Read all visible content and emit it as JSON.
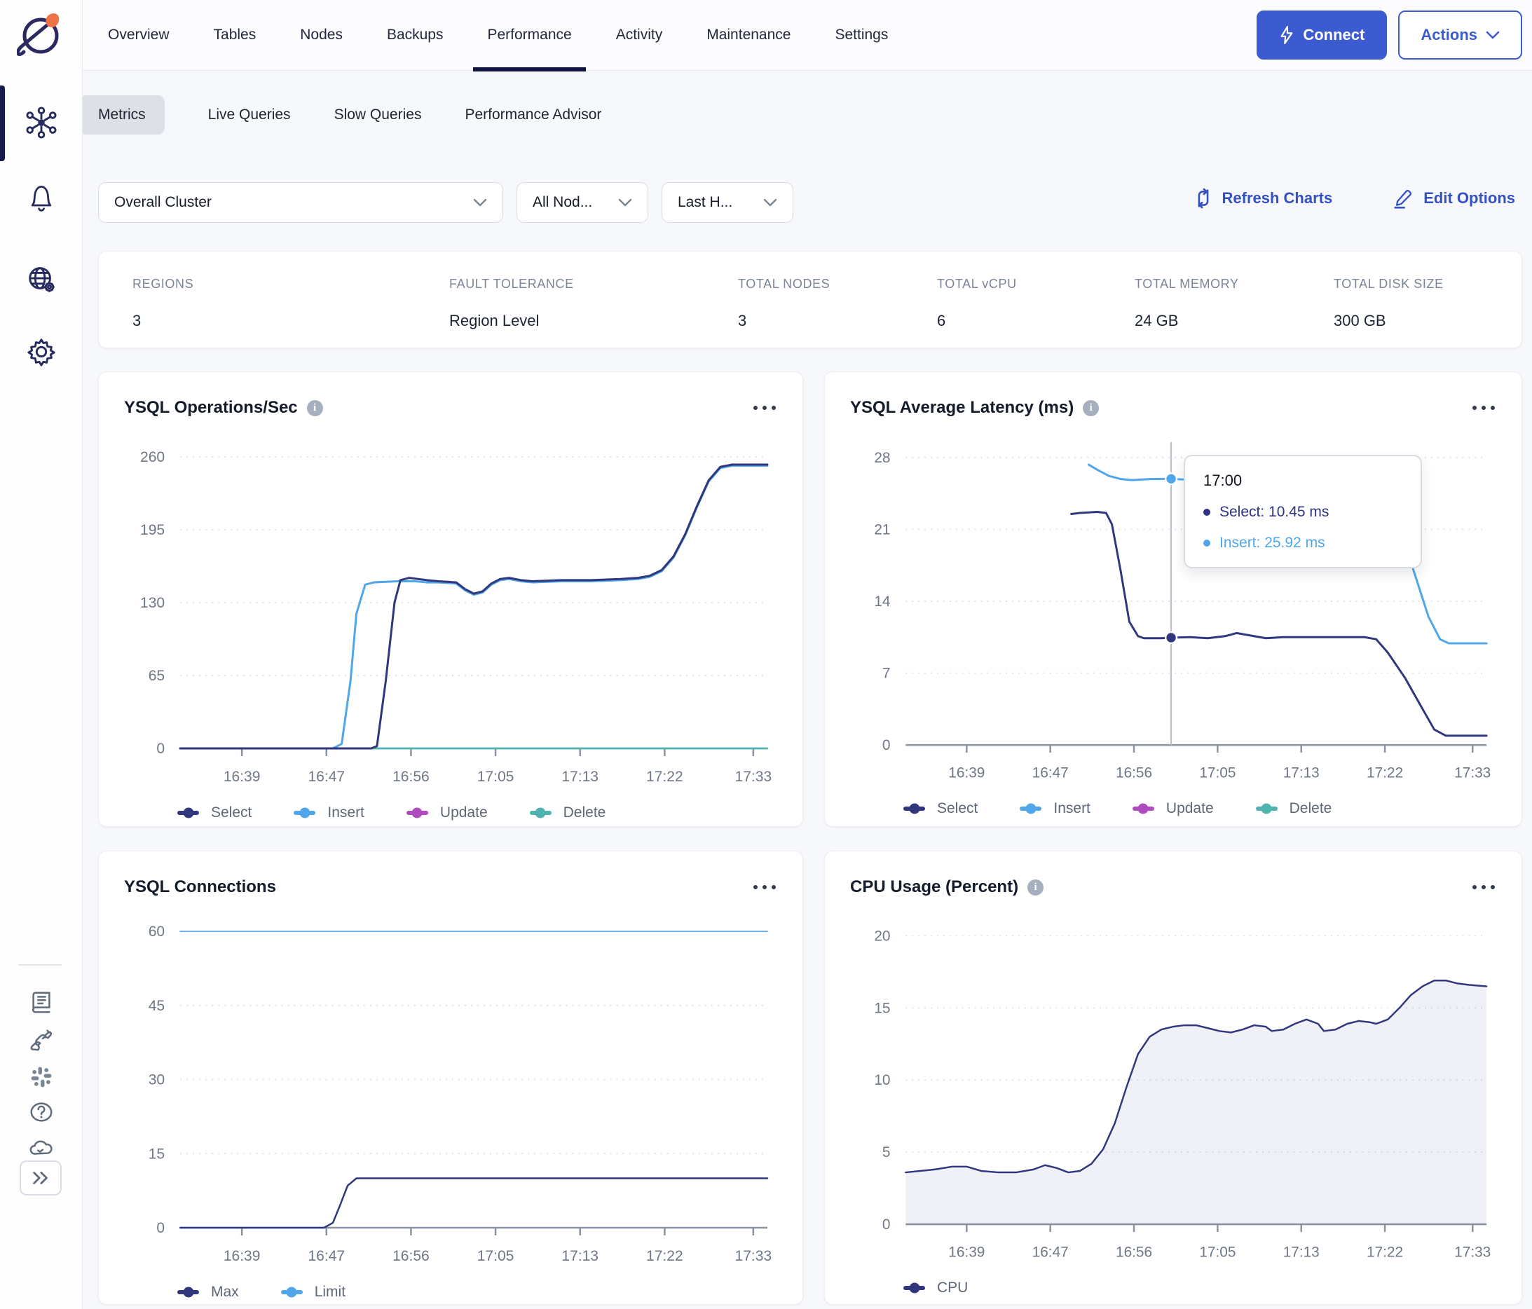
{
  "colors": {
    "brand_blue": "#3D5BD0",
    "link_blue": "#3451C0",
    "navy_series": "#31377D",
    "blue_series": "#4FA7E9",
    "magenta_series": "#B04ABF",
    "teal_series": "#4FB3AF",
    "active_tab_underline": "#12153F"
  },
  "sidebar": {
    "icons_top": [
      "yugabyte-logo",
      "cluster-icon",
      "bell-icon",
      "globe-gear-icon",
      "gear-icon"
    ],
    "icons_bottom": [
      "book-icon",
      "plug-icon",
      "slack-icon",
      "help-icon",
      "cloud-icon",
      "expand-icon"
    ]
  },
  "header": {
    "tabs": [
      "Overview",
      "Tables",
      "Nodes",
      "Backups",
      "Performance",
      "Activity",
      "Maintenance",
      "Settings"
    ],
    "active_tab": "Performance",
    "connect_label": "Connect",
    "actions_label": "Actions"
  },
  "subtabs": {
    "items": [
      "Metrics",
      "Live Queries",
      "Slow Queries",
      "Performance Advisor"
    ],
    "active": "Metrics"
  },
  "filters": {
    "cluster_value": "Overall Cluster",
    "nodes_value": "All Nod...",
    "time_value": "Last H...",
    "refresh_label": "Refresh Charts",
    "edit_label": "Edit Options"
  },
  "stats": [
    {
      "label": "REGIONS",
      "value": "3"
    },
    {
      "label": "FAULT TOLERANCE",
      "value": "Region Level"
    },
    {
      "label": "TOTAL NODES",
      "value": "3"
    },
    {
      "label": "TOTAL vCPU",
      "value": "6"
    },
    {
      "label": "TOTAL MEMORY",
      "value": "24 GB"
    },
    {
      "label": "TOTAL DISK SIZE",
      "value": "300 GB"
    }
  ],
  "charts": [
    {
      "title": "YSQL Operations/Sec",
      "type": "line",
      "has_info": true,
      "ylim": [
        0,
        273
      ],
      "yticks": [
        0,
        65,
        130,
        195,
        260
      ],
      "xticks": [
        {
          "label": "16:39",
          "f": 0.105
        },
        {
          "label": "16:47",
          "f": 0.249
        },
        {
          "label": "16:56",
          "f": 0.393
        },
        {
          "label": "17:05",
          "f": 0.537
        },
        {
          "label": "17:13",
          "f": 0.681
        },
        {
          "label": "17:22",
          "f": 0.825
        },
        {
          "label": "17:33",
          "f": 0.976
        }
      ],
      "series": [
        {
          "name": "Delete",
          "color": "#4FB3AF",
          "width": 2.5,
          "points": [
            [
              0,
              0
            ],
            [
              1,
              0
            ]
          ]
        },
        {
          "name": "Insert",
          "color": "#4FA7E9",
          "points": [
            [
              0,
              0
            ],
            [
              0.26,
              0
            ],
            [
              0.275,
              4
            ],
            [
              0.29,
              60
            ],
            [
              0.3,
              120
            ],
            [
              0.315,
              146
            ],
            [
              0.33,
              148
            ],
            [
              0.37,
              149
            ],
            [
              0.4,
              149
            ],
            [
              0.42,
              148
            ],
            [
              0.44,
              148
            ],
            [
              0.47,
              147
            ],
            [
              0.485,
              141
            ],
            [
              0.5,
              137
            ],
            [
              0.515,
              139
            ],
            [
              0.53,
              146
            ],
            [
              0.545,
              150
            ],
            [
              0.56,
              151
            ],
            [
              0.58,
              149
            ],
            [
              0.6,
              148
            ],
            [
              0.65,
              149
            ],
            [
              0.7,
              149
            ],
            [
              0.75,
              150
            ],
            [
              0.78,
              151
            ],
            [
              0.8,
              153
            ],
            [
              0.82,
              158
            ],
            [
              0.84,
              170
            ],
            [
              0.86,
              190
            ],
            [
              0.88,
              215
            ],
            [
              0.9,
              238
            ],
            [
              0.92,
              250
            ],
            [
              0.94,
              252
            ],
            [
              1,
              252
            ]
          ]
        },
        {
          "name": "Select",
          "color": "#31377D",
          "points": [
            [
              0,
              0
            ],
            [
              0.325,
              0
            ],
            [
              0.335,
              2
            ],
            [
              0.35,
              60
            ],
            [
              0.365,
              130
            ],
            [
              0.375,
              150
            ],
            [
              0.39,
              152
            ],
            [
              0.42,
              150
            ],
            [
              0.44,
              149
            ],
            [
              0.47,
              148
            ],
            [
              0.485,
              142
            ],
            [
              0.5,
              138
            ],
            [
              0.515,
              140
            ],
            [
              0.53,
              147
            ],
            [
              0.545,
              151
            ],
            [
              0.56,
              152
            ],
            [
              0.58,
              150
            ],
            [
              0.6,
              149
            ],
            [
              0.65,
              150
            ],
            [
              0.7,
              150
            ],
            [
              0.75,
              151
            ],
            [
              0.78,
              152
            ],
            [
              0.8,
              154
            ],
            [
              0.82,
              159
            ],
            [
              0.84,
              171
            ],
            [
              0.86,
              191
            ],
            [
              0.88,
              216
            ],
            [
              0.9,
              239
            ],
            [
              0.92,
              251
            ],
            [
              0.94,
              253
            ],
            [
              1,
              253
            ]
          ]
        }
      ],
      "legend": [
        {
          "label": "Select",
          "color": "#31377D"
        },
        {
          "label": "Insert",
          "color": "#4FA7E9"
        },
        {
          "label": "Update",
          "color": "#B04ABF"
        },
        {
          "label": "Delete",
          "color": "#4FB3AF"
        }
      ]
    },
    {
      "title": "YSQL Average Latency (ms)",
      "type": "line",
      "has_info": true,
      "ylim": [
        0,
        29.5
      ],
      "yticks": [
        0,
        7,
        14,
        21,
        28
      ],
      "xticks": [
        {
          "label": "16:39",
          "f": 0.105
        },
        {
          "label": "16:47",
          "f": 0.249
        },
        {
          "label": "16:56",
          "f": 0.393
        },
        {
          "label": "17:05",
          "f": 0.537
        },
        {
          "label": "17:13",
          "f": 0.681
        },
        {
          "label": "17:22",
          "f": 0.825
        },
        {
          "label": "17:33",
          "f": 0.976
        }
      ],
      "series": [
        {
          "name": "Insert",
          "color": "#4FA7E9",
          "points": [
            [
              0.315,
              27.3
            ],
            [
              0.33,
              26.8
            ],
            [
              0.35,
              26.2
            ],
            [
              0.37,
              25.9
            ],
            [
              0.39,
              25.8
            ],
            [
              0.42,
              25.9
            ],
            [
              0.457,
              25.92
            ],
            [
              0.5,
              25.8
            ],
            [
              0.53,
              25.8
            ],
            [
              0.56,
              26.0
            ],
            [
              0.6,
              26.2
            ],
            [
              0.63,
              26.1
            ],
            [
              0.66,
              25.9
            ],
            [
              0.7,
              25.8
            ],
            [
              0.73,
              25.8
            ],
            [
              0.76,
              25.8
            ],
            [
              0.79,
              25.7
            ],
            [
              0.81,
              25.0
            ],
            [
              0.83,
              23.0
            ],
            [
              0.86,
              19.5
            ],
            [
              0.88,
              16.0
            ],
            [
              0.9,
              12.5
            ],
            [
              0.92,
              10.3
            ],
            [
              0.935,
              9.9
            ],
            [
              1,
              9.9
            ]
          ]
        },
        {
          "name": "Select",
          "color": "#31377D",
          "points": [
            [
              0.285,
              22.5
            ],
            [
              0.3,
              22.6
            ],
            [
              0.33,
              22.7
            ],
            [
              0.345,
              22.6
            ],
            [
              0.355,
              21.5
            ],
            [
              0.37,
              17.0
            ],
            [
              0.385,
              12.0
            ],
            [
              0.4,
              10.6
            ],
            [
              0.41,
              10.4
            ],
            [
              0.44,
              10.4
            ],
            [
              0.457,
              10.45
            ],
            [
              0.49,
              10.5
            ],
            [
              0.52,
              10.4
            ],
            [
              0.55,
              10.6
            ],
            [
              0.57,
              10.9
            ],
            [
              0.59,
              10.7
            ],
            [
              0.62,
              10.4
            ],
            [
              0.65,
              10.5
            ],
            [
              0.7,
              10.5
            ],
            [
              0.75,
              10.5
            ],
            [
              0.79,
              10.5
            ],
            [
              0.81,
              10.3
            ],
            [
              0.83,
              9.0
            ],
            [
              0.86,
              6.5
            ],
            [
              0.89,
              3.5
            ],
            [
              0.91,
              1.5
            ],
            [
              0.93,
              0.9
            ],
            [
              1,
              0.9
            ]
          ]
        }
      ],
      "crosshair": {
        "f": 0.457,
        "dots": [
          {
            "v": 25.92,
            "color": "#4FA7E9"
          },
          {
            "v": 10.45,
            "color": "#31377D"
          }
        ]
      },
      "tooltip": {
        "time": "17:00",
        "rows": [
          {
            "text": "Select: 10.45 ms",
            "color": "#2D3282"
          },
          {
            "text": "Insert: 25.92 ms",
            "color": "#4FA7E9"
          }
        ]
      },
      "legend": [
        {
          "label": "Select",
          "color": "#31377D"
        },
        {
          "label": "Insert",
          "color": "#4FA7E9"
        },
        {
          "label": "Update",
          "color": "#B04ABF"
        },
        {
          "label": "Delete",
          "color": "#4FB3AF"
        }
      ]
    },
    {
      "title": "YSQL Connections",
      "type": "line",
      "has_info": false,
      "ylim": [
        0,
        62
      ],
      "yticks": [
        0,
        15,
        30,
        45,
        60
      ],
      "xticks": [
        {
          "label": "16:39",
          "f": 0.105
        },
        {
          "label": "16:47",
          "f": 0.249
        },
        {
          "label": "16:56",
          "f": 0.393
        },
        {
          "label": "17:05",
          "f": 0.537
        },
        {
          "label": "17:13",
          "f": 0.681
        },
        {
          "label": "17:22",
          "f": 0.825
        },
        {
          "label": "17:33",
          "f": 0.976
        }
      ],
      "series": [
        {
          "name": "Limit",
          "color": "#6FB3EC",
          "width": 2,
          "points": [
            [
              0,
              60
            ],
            [
              1,
              60
            ]
          ]
        },
        {
          "name": "Max",
          "color": "#31377D",
          "width": 2.5,
          "points": [
            [
              0,
              0
            ],
            [
              0.245,
              0
            ],
            [
              0.26,
              1
            ],
            [
              0.272,
              4.5
            ],
            [
              0.285,
              8.5
            ],
            [
              0.3,
              10
            ],
            [
              1,
              10
            ]
          ]
        }
      ],
      "legend": [
        {
          "label": "Max",
          "color": "#31377D"
        },
        {
          "label": "Limit",
          "color": "#4FA7E9"
        }
      ]
    },
    {
      "title": "CPU Usage (Percent)",
      "type": "area",
      "has_info": true,
      "ylim": [
        0,
        21
      ],
      "yticks": [
        0,
        5,
        10,
        15,
        20
      ],
      "xticks": [
        {
          "label": "16:39",
          "f": 0.105
        },
        {
          "label": "16:47",
          "f": 0.249
        },
        {
          "label": "16:56",
          "f": 0.393
        },
        {
          "label": "17:05",
          "f": 0.537
        },
        {
          "label": "17:13",
          "f": 0.681
        },
        {
          "label": "17:22",
          "f": 0.825
        },
        {
          "label": "17:33",
          "f": 0.976
        }
      ],
      "series": [
        {
          "name": "CPU",
          "color": "#31377D",
          "width": 2.5,
          "area": true,
          "points": [
            [
              0,
              3.6
            ],
            [
              0.05,
              3.8
            ],
            [
              0.08,
              4.0
            ],
            [
              0.105,
              4.0
            ],
            [
              0.13,
              3.7
            ],
            [
              0.16,
              3.6
            ],
            [
              0.19,
              3.6
            ],
            [
              0.22,
              3.8
            ],
            [
              0.24,
              4.1
            ],
            [
              0.26,
              3.9
            ],
            [
              0.28,
              3.6
            ],
            [
              0.3,
              3.7
            ],
            [
              0.32,
              4.2
            ],
            [
              0.34,
              5.2
            ],
            [
              0.36,
              7.0
            ],
            [
              0.38,
              9.5
            ],
            [
              0.4,
              11.8
            ],
            [
              0.42,
              13.0
            ],
            [
              0.44,
              13.5
            ],
            [
              0.46,
              13.7
            ],
            [
              0.48,
              13.8
            ],
            [
              0.5,
              13.8
            ],
            [
              0.52,
              13.6
            ],
            [
              0.54,
              13.4
            ],
            [
              0.56,
              13.3
            ],
            [
              0.58,
              13.5
            ],
            [
              0.6,
              13.8
            ],
            [
              0.62,
              13.7
            ],
            [
              0.63,
              13.4
            ],
            [
              0.65,
              13.5
            ],
            [
              0.67,
              13.9
            ],
            [
              0.69,
              14.2
            ],
            [
              0.71,
              13.9
            ],
            [
              0.72,
              13.4
            ],
            [
              0.74,
              13.5
            ],
            [
              0.76,
              13.9
            ],
            [
              0.78,
              14.1
            ],
            [
              0.8,
              14.0
            ],
            [
              0.81,
              13.9
            ],
            [
              0.83,
              14.2
            ],
            [
              0.85,
              15.0
            ],
            [
              0.87,
              15.9
            ],
            [
              0.89,
              16.5
            ],
            [
              0.91,
              16.9
            ],
            [
              0.93,
              16.9
            ],
            [
              0.95,
              16.7
            ],
            [
              0.97,
              16.6
            ],
            [
              1,
              16.5
            ]
          ]
        }
      ],
      "legend": [
        {
          "label": "CPU",
          "color": "#31377D"
        }
      ]
    }
  ]
}
